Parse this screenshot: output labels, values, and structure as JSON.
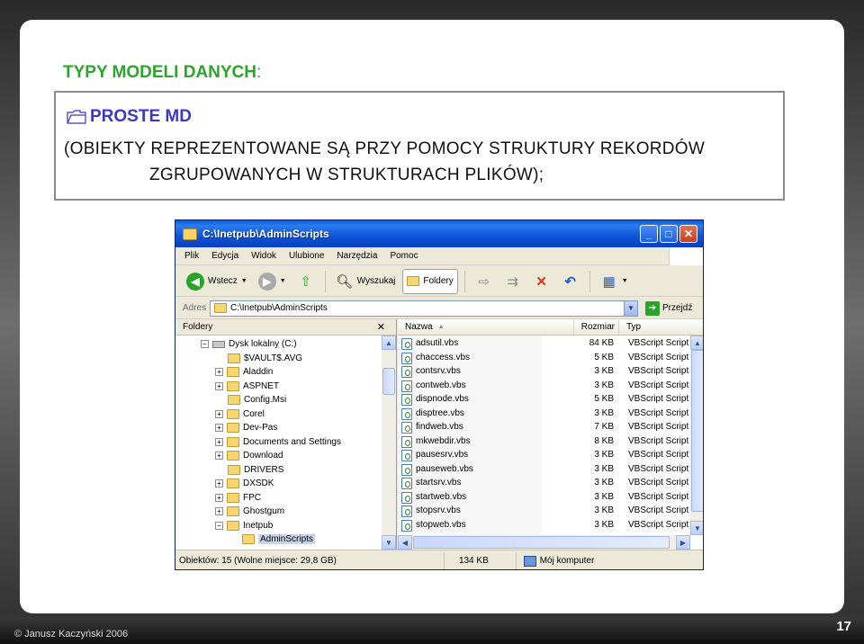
{
  "slide": {
    "title": "TYPY MODELI DANYCH",
    "title_colon": ":",
    "heading": "PROSTE MD",
    "line1": "(OBIEKTY REPREZENTOWANE SĄ PRZY POMOCY STRUKTURY  REKORDÓW",
    "line2": "ZGRUPOWANYCH W STRUKTURACH PLIKÓW);",
    "footer": "© Janusz Kaczyński 2006",
    "page_number": "17",
    "colors": {
      "title": "#2ca52c",
      "heading": "#3f35c9"
    }
  },
  "window": {
    "title": "C:\\Inetpub\\AdminScripts",
    "menu": [
      "Plik",
      "Edycja",
      "Widok",
      "Ulubione",
      "Narzędzia",
      "Pomoc"
    ],
    "toolbar": {
      "back": "Wstecz",
      "search": "Wyszukaj",
      "folders": "Foldery"
    },
    "address": {
      "label": "Adres",
      "value": "C:\\Inetpub\\AdminScripts",
      "go": "Przejdź"
    },
    "folder_pane": {
      "title": "Foldery",
      "tree": [
        {
          "label": "Dysk lokalny (C:)",
          "toggle": "−",
          "level": 0
        },
        {
          "label": "$VAULT$.AVG",
          "toggle": "",
          "level": 1
        },
        {
          "label": "Aladdin",
          "toggle": "+",
          "level": 1
        },
        {
          "label": "ASPNET",
          "toggle": "+",
          "level": 1
        },
        {
          "label": "Config.Msi",
          "toggle": "",
          "level": 1
        },
        {
          "label": "Corel",
          "toggle": "+",
          "level": 1
        },
        {
          "label": "Dev-Pas",
          "toggle": "+",
          "level": 1
        },
        {
          "label": "Documents and Settings",
          "toggle": "+",
          "level": 1
        },
        {
          "label": "Download",
          "toggle": "+",
          "level": 1
        },
        {
          "label": "DRIVERS",
          "toggle": "",
          "level": 1
        },
        {
          "label": "DXSDK",
          "toggle": "+",
          "level": 1
        },
        {
          "label": "FPC",
          "toggle": "+",
          "level": 1
        },
        {
          "label": "Ghostgum",
          "toggle": "+",
          "level": 1
        },
        {
          "label": "Inetpub",
          "toggle": "−",
          "level": 1
        },
        {
          "label": "AdminScripts",
          "toggle": "",
          "level": 2,
          "selected": true
        }
      ]
    },
    "file_pane": {
      "columns": {
        "name": "Nazwa",
        "size": "Rozmiar",
        "type": "Typ"
      },
      "files": [
        {
          "name": "adsutil.vbs",
          "size": "84 KB",
          "type": "VBScript Script"
        },
        {
          "name": "chaccess.vbs",
          "size": "5 KB",
          "type": "VBScript Script"
        },
        {
          "name": "contsrv.vbs",
          "size": "3 KB",
          "type": "VBScript Script"
        },
        {
          "name": "contweb.vbs",
          "size": "3 KB",
          "type": "VBScript Script"
        },
        {
          "name": "dispnode.vbs",
          "size": "5 KB",
          "type": "VBScript Script"
        },
        {
          "name": "disptree.vbs",
          "size": "3 KB",
          "type": "VBScript Script"
        },
        {
          "name": "findweb.vbs",
          "size": "7 KB",
          "type": "VBScript Script"
        },
        {
          "name": "mkwebdir.vbs",
          "size": "8 KB",
          "type": "VBScript Script"
        },
        {
          "name": "pausesrv.vbs",
          "size": "3 KB",
          "type": "VBScript Script"
        },
        {
          "name": "pauseweb.vbs",
          "size": "3 KB",
          "type": "VBScript Script"
        },
        {
          "name": "startsrv.vbs",
          "size": "3 KB",
          "type": "VBScript Script"
        },
        {
          "name": "startweb.vbs",
          "size": "3 KB",
          "type": "VBScript Script"
        },
        {
          "name": "stopsrv.vbs",
          "size": "3 KB",
          "type": "VBScript Script"
        },
        {
          "name": "stopweb.vbs",
          "size": "3 KB",
          "type": "VBScript Script"
        }
      ]
    },
    "status": {
      "objects": "Obiektów: 15 (Wolne miejsce: 29,8 GB)",
      "size": "134 KB",
      "location": "Mój komputer"
    }
  }
}
